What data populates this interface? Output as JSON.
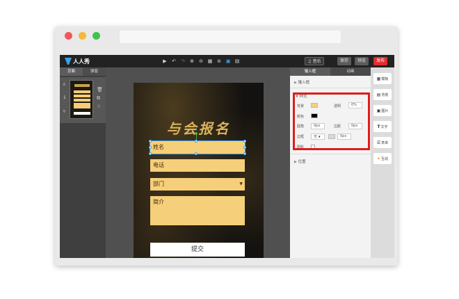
{
  "toolbar": {
    "logo_text": "人人秀",
    "tools": [
      "▶",
      "↶",
      "↷",
      "⊕",
      "⊖",
      "▦",
      "⊜",
      "▣",
      "▤"
    ],
    "music_label": "♫ 音乐",
    "save_label": "保存",
    "preview_label": "预览",
    "publish_label": "发布"
  },
  "left_panel": {
    "tabs": [
      "页面",
      "弹窗"
    ],
    "page_number": "1"
  },
  "canvas": {
    "title": "与会报名",
    "fields": {
      "name": "姓名",
      "phone": "电话",
      "department": "部门",
      "intro": "简介"
    },
    "submit_label": "提交"
  },
  "right_panel": {
    "tabs": [
      "输入框",
      "动画"
    ],
    "section_input": "输入框",
    "section_style": "样式",
    "bg_label": "背景",
    "opacity_label": "透明",
    "opacity_value": "0%",
    "color_label": "颜色",
    "radius_label": "圆角",
    "radius_value": "0px",
    "margin_label": "边距",
    "margin_value": "0px",
    "border_label": "边框",
    "border_style_value": "无",
    "border_width_value": "0px",
    "shadow_label": "阴影",
    "section_position": "位置",
    "bg_color": "#f6cf7a",
    "text_color": "#000000"
  },
  "right_toolbar": {
    "items": [
      {
        "label": "模板",
        "icon": "template-icon"
      },
      {
        "label": "背景",
        "icon": "background-icon"
      },
      {
        "label": "图片",
        "icon": "image-icon"
      },
      {
        "label": "文字",
        "icon": "text-icon"
      },
      {
        "label": "表单",
        "icon": "form-icon"
      },
      {
        "label": "互动",
        "icon": "interaction-icon"
      }
    ]
  }
}
